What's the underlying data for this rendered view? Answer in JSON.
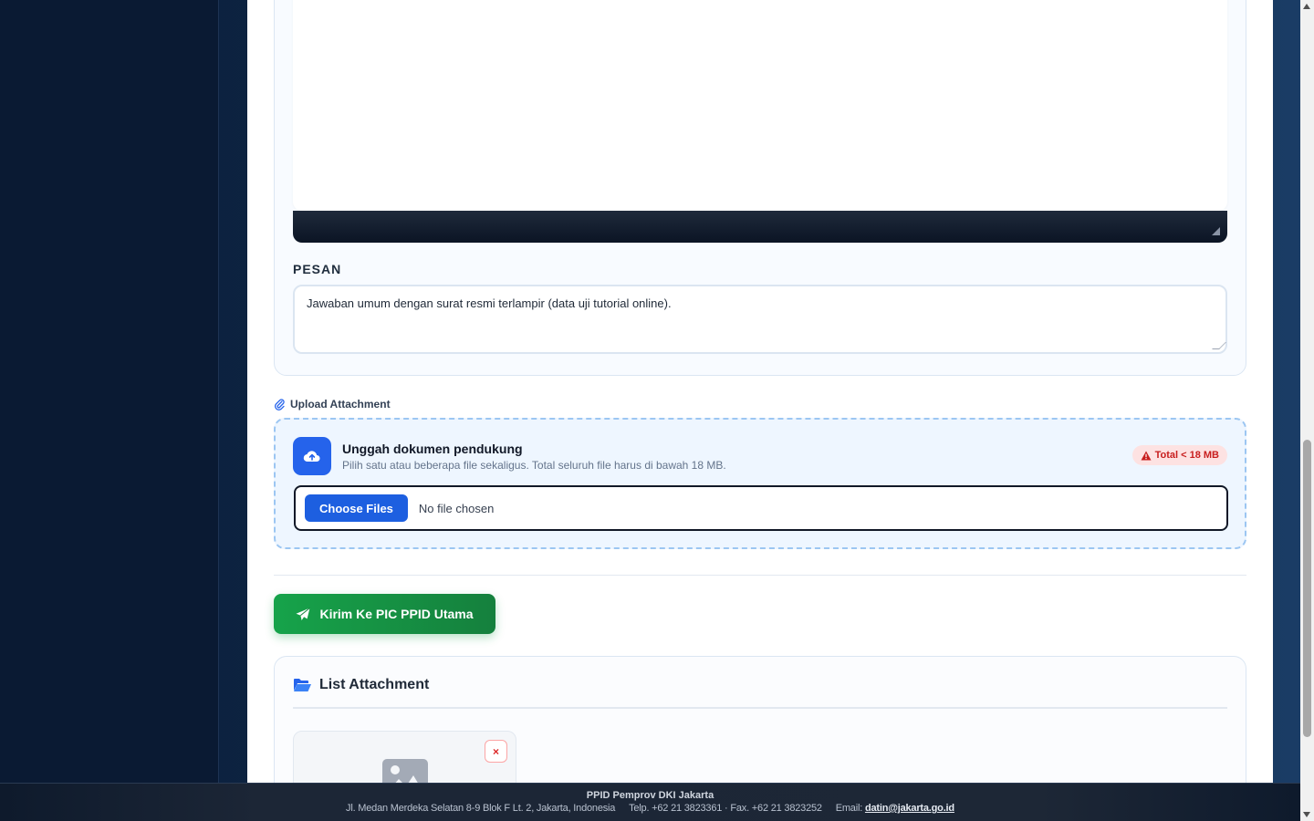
{
  "form": {
    "pesan_label": "PESAN",
    "pesan_value": "Jawaban umum dengan surat resmi terlampir (data uji tutorial online)."
  },
  "upload": {
    "section_title": "Upload Attachment",
    "heading": "Unggah dokumen pendukung",
    "subtext": "Pilih satu atau beberapa file sekaligus. Total seluruh file harus di bawah 18 MB.",
    "badge": "Total < 18 MB",
    "choose_label": "Choose Files",
    "no_file": "No file chosen"
  },
  "actions": {
    "send_label": "Kirim Ke PIC PPID Utama"
  },
  "list": {
    "title": "List Attachment",
    "remove_label": "×"
  },
  "footer": {
    "org": "PPID Pemprov DKI Jakarta",
    "address": "Jl. Medan Merdeka Selatan 8-9 Blok F Lt. 2, Jakarta, Indonesia",
    "phone": "Telp. +62 21 3823361 · Fax. +62 21 3823252",
    "email_label": "Email:",
    "email": "datin@jakarta.go.id"
  },
  "colors": {
    "primary": "#2563eb",
    "success": "#16a34a",
    "danger": "#c81e1e"
  }
}
